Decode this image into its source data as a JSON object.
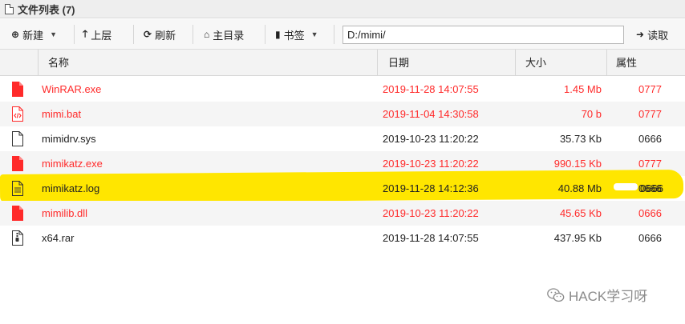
{
  "window": {
    "title": "文件列表 (7)"
  },
  "toolbar": {
    "new_label": "新建",
    "up_label": "上层",
    "refresh_label": "刷新",
    "home_label": "主目录",
    "bookmark_label": "书签",
    "read_label": "读取",
    "path_value": "D:/mimi/"
  },
  "columns": {
    "name": "名称",
    "date": "日期",
    "size": "大小",
    "attr": "属性"
  },
  "files": [
    {
      "name": "WinRAR.exe",
      "date": "2019-11-28 14:07:55",
      "size": "1.45 Mb",
      "attr": "0777",
      "icon": "file-red-icon",
      "color": "#ff2a2a"
    },
    {
      "name": "mimi.bat",
      "date": "2019-11-04 14:30:58",
      "size": "70 b",
      "attr": "0777",
      "icon": "file-code-icon",
      "color": "#ff2a2a"
    },
    {
      "name": "mimidrv.sys",
      "date": "2019-10-23 11:20:22",
      "size": "35.73 Kb",
      "attr": "0666",
      "icon": "file-outline-icon",
      "color": "#222222"
    },
    {
      "name": "mimikatz.exe",
      "date": "2019-10-23 11:20:22",
      "size": "990.15 Kb",
      "attr": "0777",
      "icon": "file-red-icon",
      "color": "#ff2a2a"
    },
    {
      "name": "mimikatz.log",
      "date": "2019-11-28 14:12:36",
      "size": "40.88 Mb",
      "attr": "0666",
      "icon": "file-text-icon",
      "color": "#222222"
    },
    {
      "name": "mimilib.dll",
      "date": "2019-10-23 11:20:22",
      "size": "45.65 Kb",
      "attr": "0666",
      "icon": "file-red-icon",
      "color": "#ff2a2a"
    },
    {
      "name": "x64.rar",
      "date": "2019-11-28 14:07:55",
      "size": "437.95 Kb",
      "attr": "0666",
      "icon": "file-archive-icon",
      "color": "#222222"
    }
  ],
  "watermark": {
    "text": "HACK学习呀"
  },
  "colors": {
    "executable": "#ff2a2a",
    "highlight": "#ffe600"
  }
}
